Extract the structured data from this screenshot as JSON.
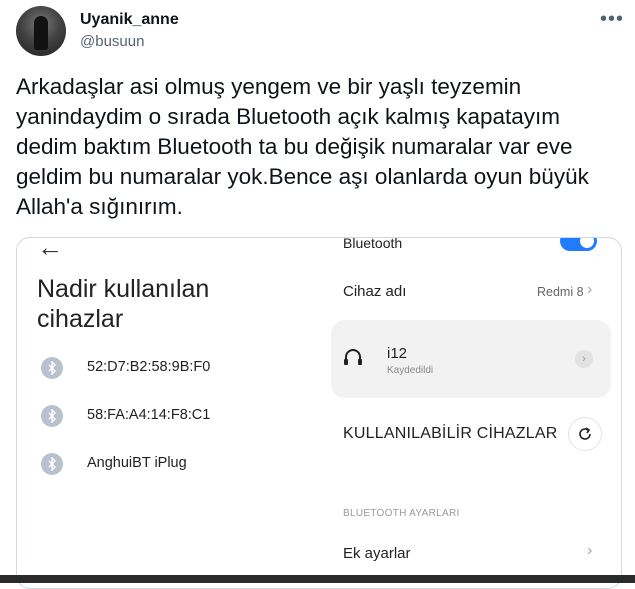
{
  "tweet": {
    "display_name": "Uyanik_anne",
    "handle": "@busuun",
    "more_icon": "more-horizontal-icon",
    "text": "Arkadaşlar asi olmuş yengem ve bir yaşlı teyzemin yanindaydim o sırada Bluetooth açık kalmış kapatayım dedim baktım Bluetooth ta bu değişik numaralar var eve geldim bu numaralar yok.Bence aşı olanlarda oyun büyük Allah'a sığınırım."
  },
  "screenshot_left": {
    "title": "Nadir kullanılan cihazlar",
    "devices": [
      {
        "label": "52:D7:B2:58:9B:F0",
        "icon": "bluetooth-icon"
      },
      {
        "label": "58:FA:A4:14:F8:C1",
        "icon": "bluetooth-icon"
      },
      {
        "label": "AnghuiBT iPlug",
        "icon": "bluetooth-icon"
      }
    ]
  },
  "screenshot_right": {
    "bluetooth_label": "Bluetooth",
    "bluetooth_on": true,
    "device_name_label": "Cihaz adı",
    "device_name_value": "Redmi 8",
    "paired_device": {
      "name": "i12",
      "status": "Kaydedildi",
      "icon": "headphones-icon"
    },
    "available_devices_label": "KULLANILABİLİR CİHAZLAR",
    "settings_header": "BLUETOOTH AYARLARI",
    "more_settings_label": "Ek ayarlar"
  },
  "colors": {
    "toggle_on": "#1f7cff",
    "text_primary": "#0f1419",
    "text_secondary": "#536471",
    "card_border": "#cfd9de"
  }
}
